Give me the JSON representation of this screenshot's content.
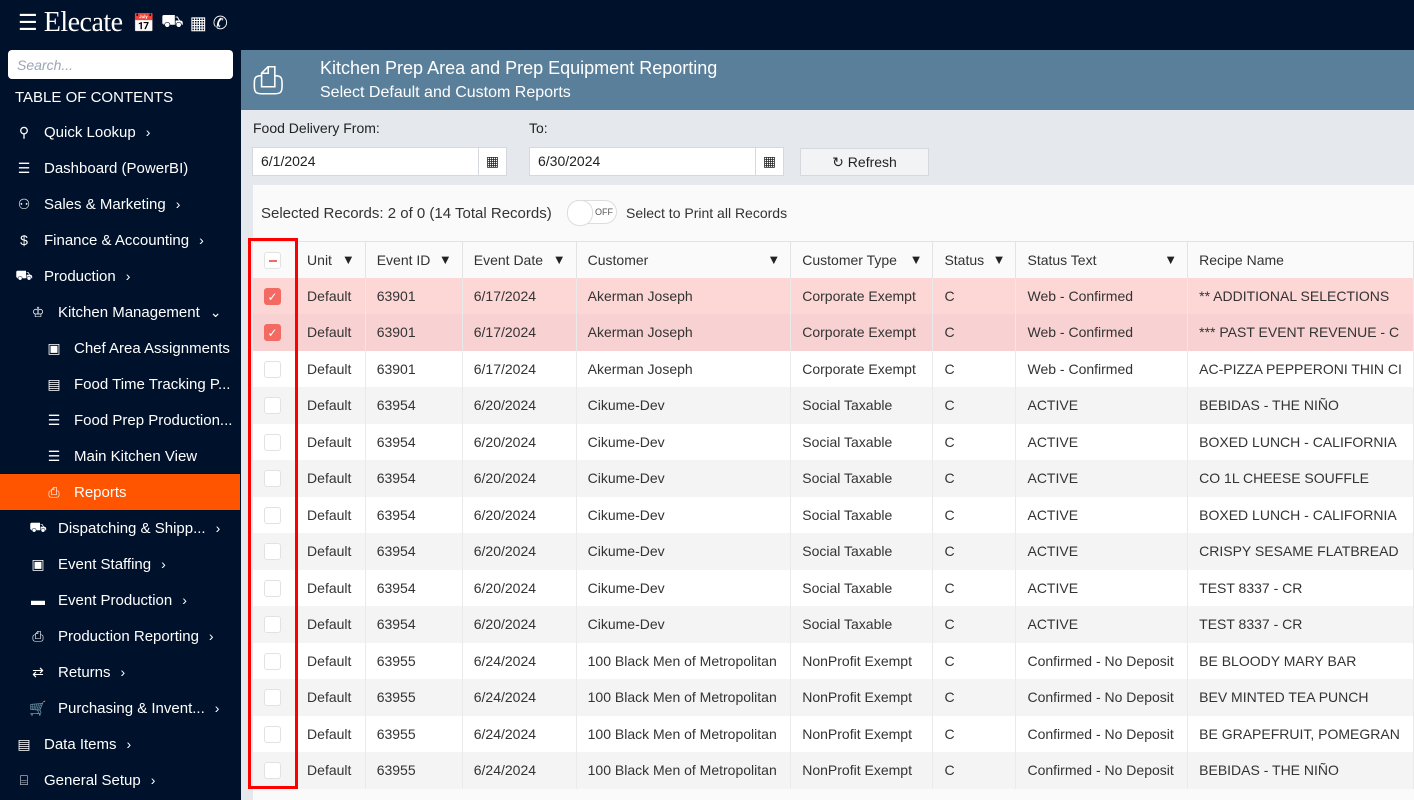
{
  "app": {
    "logo": "Elecate",
    "top_icons": [
      "calendar-icon",
      "truck-icon",
      "building-icon",
      "phone-icon"
    ]
  },
  "sidebar": {
    "search_placeholder": "Search...",
    "toc_label": "TABLE OF CONTENTS",
    "items": [
      {
        "label": "Quick Lookup",
        "icon": "search-icon",
        "glyph": "⚲",
        "level": 0,
        "chev": "›"
      },
      {
        "label": "Dashboard (PowerBI)",
        "icon": "list-icon",
        "glyph": "☰",
        "level": 0,
        "chev": ""
      },
      {
        "label": "Sales & Marketing",
        "icon": "people-icon",
        "glyph": "⚇",
        "level": 0,
        "chev": "›"
      },
      {
        "label": "Finance & Accounting",
        "icon": "money-icon",
        "glyph": "$",
        "level": 0,
        "chev": "›"
      },
      {
        "label": "Production",
        "icon": "forklift-icon",
        "glyph": "⛟",
        "level": 0,
        "chev": "›"
      },
      {
        "label": "Kitchen Management",
        "icon": "chef-hat-icon",
        "glyph": "♔",
        "level": 1,
        "chev": "⌄"
      },
      {
        "label": "Chef Area Assignments",
        "icon": "badge-icon",
        "glyph": "▣",
        "level": 2,
        "chev": ""
      },
      {
        "label": "Food Time Tracking P...",
        "icon": "clipboard-icon",
        "glyph": "▤",
        "level": 2,
        "chev": ""
      },
      {
        "label": "Food Prep Production...",
        "icon": "list-icon",
        "glyph": "☰",
        "level": 2,
        "chev": ""
      },
      {
        "label": "Main Kitchen View",
        "icon": "list-icon",
        "glyph": "☰",
        "level": 2,
        "chev": ""
      },
      {
        "label": "Reports",
        "icon": "printer-icon",
        "glyph": "⎙",
        "level": 2,
        "chev": "",
        "active": true
      },
      {
        "label": "Dispatching & Shipp...",
        "icon": "truck-icon",
        "glyph": "⛟",
        "level": 1,
        "chev": "›"
      },
      {
        "label": "Event Staffing",
        "icon": "badge-icon",
        "glyph": "▣",
        "level": 1,
        "chev": "›"
      },
      {
        "label": "Event Production",
        "icon": "conveyor-icon",
        "glyph": "▬",
        "level": 1,
        "chev": "›"
      },
      {
        "label": "Production Reporting",
        "icon": "printer-icon",
        "glyph": "⎙",
        "level": 1,
        "chev": "›"
      },
      {
        "label": "Returns",
        "icon": "exchange-icon",
        "glyph": "⇄",
        "level": 1,
        "chev": "›"
      },
      {
        "label": "Purchasing & Invent...",
        "icon": "cart-icon",
        "glyph": "🛒",
        "level": 1,
        "chev": "›"
      },
      {
        "label": "Data Items",
        "icon": "drawer-icon",
        "glyph": "▤",
        "level": 0,
        "chev": "›"
      },
      {
        "label": "General Setup",
        "icon": "toolbox-icon",
        "glyph": "⌸",
        "level": 0,
        "chev": "›"
      }
    ]
  },
  "header": {
    "title": "Kitchen Prep Area and Prep Equipment Reporting",
    "subtitle": "Select Default and Custom Reports"
  },
  "filters": {
    "from_label": "Food Delivery From:",
    "from_value": "6/1/2024",
    "to_label": "To:",
    "to_value": "6/30/2024",
    "refresh_label": "Refresh"
  },
  "selection": {
    "info": "Selected Records: 2 of 0 (14 Total Records)",
    "toggle_state": "OFF",
    "toggle_label": "Select to Print all Records"
  },
  "table": {
    "columns": [
      "Unit",
      "Event ID",
      "Event Date",
      "Customer",
      "Customer Type",
      "Status",
      "Status Text",
      "Recipe Name"
    ],
    "filterable": [
      true,
      true,
      true,
      true,
      true,
      true,
      true,
      false
    ],
    "rows": [
      {
        "checked": true,
        "cells": [
          "Default",
          "63901",
          "6/17/2024",
          "Akerman Joseph",
          "Corporate Exempt",
          "C",
          "Web - Confirmed",
          "** ADDITIONAL SELECTIONS"
        ]
      },
      {
        "checked": true,
        "cells": [
          "Default",
          "63901",
          "6/17/2024",
          "Akerman Joseph",
          "Corporate Exempt",
          "C",
          "Web - Confirmed",
          "*** PAST EVENT REVENUE - C"
        ]
      },
      {
        "checked": false,
        "cells": [
          "Default",
          "63901",
          "6/17/2024",
          "Akerman Joseph",
          "Corporate Exempt",
          "C",
          "Web - Confirmed",
          "AC-PIZZA PEPPERONI THIN CI"
        ]
      },
      {
        "checked": false,
        "cells": [
          "Default",
          "63954",
          "6/20/2024",
          "Cikume-Dev",
          "Social Taxable",
          "C",
          "ACTIVE",
          "BEBIDAS - THE NIÑO"
        ]
      },
      {
        "checked": false,
        "cells": [
          "Default",
          "63954",
          "6/20/2024",
          "Cikume-Dev",
          "Social Taxable",
          "C",
          "ACTIVE",
          "BOXED LUNCH - CALIFORNIA"
        ]
      },
      {
        "checked": false,
        "cells": [
          "Default",
          "63954",
          "6/20/2024",
          "Cikume-Dev",
          "Social Taxable",
          "C",
          "ACTIVE",
          "CO 1L CHEESE SOUFFLE"
        ]
      },
      {
        "checked": false,
        "cells": [
          "Default",
          "63954",
          "6/20/2024",
          "Cikume-Dev",
          "Social Taxable",
          "C",
          "ACTIVE",
          "BOXED LUNCH - CALIFORNIA"
        ]
      },
      {
        "checked": false,
        "cells": [
          "Default",
          "63954",
          "6/20/2024",
          "Cikume-Dev",
          "Social Taxable",
          "C",
          "ACTIVE",
          "CRISPY SESAME FLATBREAD"
        ]
      },
      {
        "checked": false,
        "cells": [
          "Default",
          "63954",
          "6/20/2024",
          "Cikume-Dev",
          "Social Taxable",
          "C",
          "ACTIVE",
          "TEST 8337 - CR"
        ]
      },
      {
        "checked": false,
        "cells": [
          "Default",
          "63954",
          "6/20/2024",
          "Cikume-Dev",
          "Social Taxable",
          "C",
          "ACTIVE",
          "TEST 8337 - CR"
        ]
      },
      {
        "checked": false,
        "cells": [
          "Default",
          "63955",
          "6/24/2024",
          "100 Black Men of Metropolitan",
          "NonProfit Exempt",
          "C",
          "Confirmed - No Deposit",
          "BE BLOODY MARY BAR"
        ]
      },
      {
        "checked": false,
        "cells": [
          "Default",
          "63955",
          "6/24/2024",
          "100 Black Men of Metropolitan",
          "NonProfit Exempt",
          "C",
          "Confirmed - No Deposit",
          "BEV MINTED TEA PUNCH"
        ]
      },
      {
        "checked": false,
        "cells": [
          "Default",
          "63955",
          "6/24/2024",
          "100 Black Men of Metropolitan",
          "NonProfit Exempt",
          "C",
          "Confirmed - No Deposit",
          "BE GRAPEFRUIT, POMEGRAN"
        ]
      },
      {
        "checked": false,
        "cells": [
          "Default",
          "63955",
          "6/24/2024",
          "100 Black Men of Metropolitan",
          "NonProfit Exempt",
          "C",
          "Confirmed - No Deposit",
          "BEBIDAS - THE NIÑO"
        ]
      }
    ]
  },
  "colors": {
    "nav_bg": "#00112b",
    "active": "#ff5500",
    "banner": "#5a7f9a",
    "selected_row": "#fdd6d6",
    "checkbox": "#f36a63",
    "highlight_box": "#ff0000"
  }
}
